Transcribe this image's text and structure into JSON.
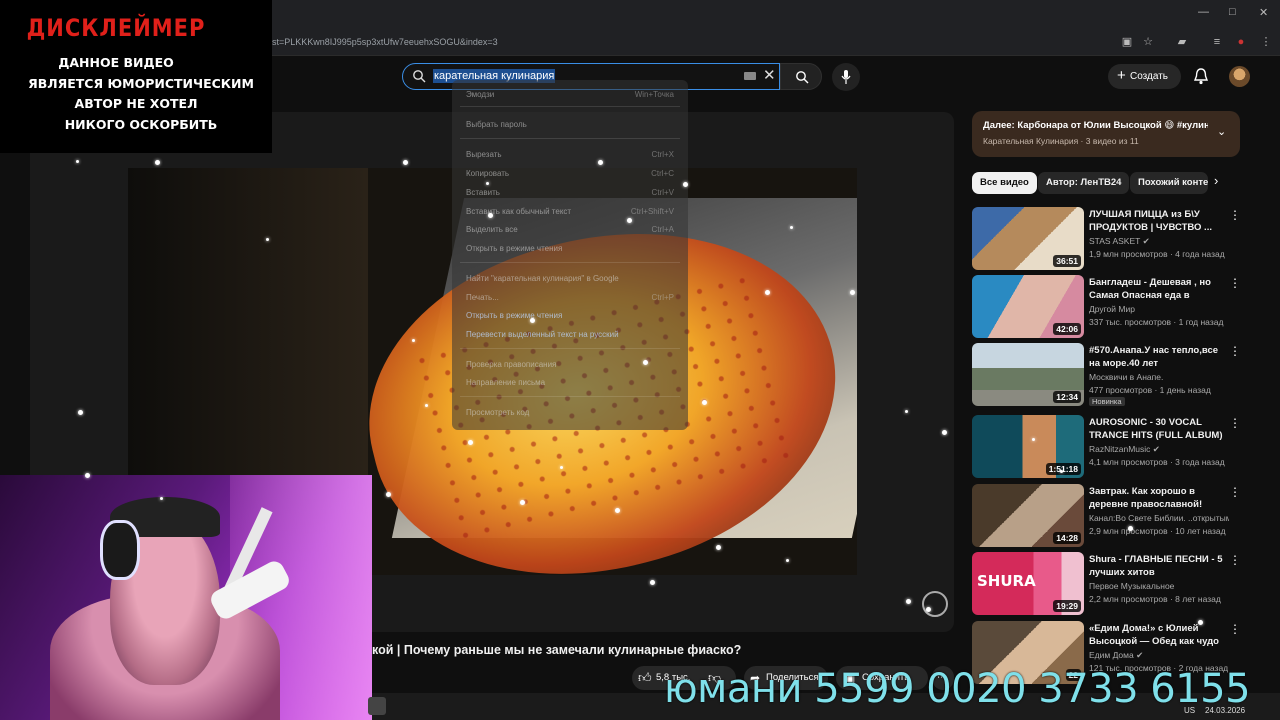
{
  "browser": {
    "url": "st=PLKKKwn8IJ995p5sp3xtUfw7eeuehxSOGU&index=3"
  },
  "header": {
    "search_value": "карательная кулинария",
    "create_label": "Создать"
  },
  "context_menu": {
    "items": [
      {
        "label": "Эмодзи",
        "shortcut": "Win+Точка"
      },
      {
        "label": "Выбрать пароль",
        "shortcut": ""
      },
      {
        "label": "Вырезать",
        "shortcut": "Ctrl+X"
      },
      {
        "label": "Копировать",
        "shortcut": "Ctrl+C"
      },
      {
        "label": "Вставить",
        "shortcut": "Ctrl+V"
      },
      {
        "label": "Вставить как обычный текст",
        "shortcut": "Ctrl+Shift+V"
      },
      {
        "label": "Выделить все",
        "shortcut": "Ctrl+A"
      },
      {
        "label": "Открыть в режиме чтения",
        "shortcut": ""
      },
      {
        "label": "Найти \"карательная кулинария\" в Google",
        "shortcut": ""
      },
      {
        "label": "Печать...",
        "shortcut": "Ctrl+P"
      },
      {
        "label": "Открыть в режиме чтения",
        "shortcut": ""
      },
      {
        "label": "Перевести выделенный текст на русский",
        "shortcut": ""
      },
      {
        "label": "Проверка правописания",
        "shortcut": ""
      },
      {
        "label": "Направление письма",
        "shortcut": ""
      },
      {
        "label": "Просмотреть код",
        "shortcut": ""
      }
    ]
  },
  "disclaimer": {
    "title": "ДИСКЛЕЙМЕР",
    "lines": [
      "ДАННОЕ ВИДЕО",
      "ЯВЛЯЕТСЯ ЮМОРИСТИЧЕСКИМ",
      "АВТОР НЕ ХОТЕЛ",
      "НИКОГО ОСКОРБИТЬ"
    ]
  },
  "video": {
    "title": "кой | Почему раньше мы не замечали кулинарные фиаско?",
    "likes": "5,8 тыс.",
    "share_label": "Поделиться",
    "save_label": "Сохранить"
  },
  "up_next": {
    "title": "Далее: Карбонара от Юлии Высоцкой 😄 #кулинария",
    "subtitle": "Карательная Кулинария · 3 видео из 11"
  },
  "chips": [
    "Все видео",
    "Автор: ЛенТВ24",
    "Похожий контент"
  ],
  "recommendations": [
    {
      "title": "ЛУЧШАЯ ПИЦЦА из Б\\У ПРОДУКТОВ | ЧУВСТВО ...",
      "channel": "STAS ASKET",
      "verified": true,
      "meta": "1,9 млн просмотров · 4 года назад",
      "duration": "36:51",
      "badge": "",
      "thumb_color": "#7a6a52"
    },
    {
      "title": "Бангладеш - Дешевая , но Самая Опасная еда в МИРЕ!!!",
      "channel": "Другой Мир",
      "verified": false,
      "meta": "337 тыс. просмотров · 1 год назад",
      "duration": "42:06",
      "badge": "",
      "thumb_color": "#c08080"
    },
    {
      "title": "#570.Анапа.У нас тепло,все на море.40 лет Победы.Белка, ...",
      "channel": "Москвичи в Анапе.",
      "verified": false,
      "meta": "477 просмотров · 1 день назад",
      "duration": "12:34",
      "badge": "Новинка",
      "thumb_color": "#6a7a6a"
    },
    {
      "title": "AUROSONIC - 30 VOCAL TRANCE HITS (FULL ALBUM)",
      "channel": "RazNitzanMusic",
      "verified": true,
      "meta": "4,1 млн просмотров · 3 года назад",
      "duration": "1:51:18",
      "badge": "",
      "thumb_color": "#1a6a7a"
    },
    {
      "title": "Завтрак. Как хорошо в деревне православной!",
      "channel": "Канал:Во Свете Библии. ..открытым о...",
      "verified": false,
      "meta": "2,9 млн просмотров · 10 лет назад",
      "duration": "14:28",
      "badge": "",
      "thumb_color": "#6a5a4a"
    },
    {
      "title": "Shura - ГЛАВНЫЕ ПЕСНИ - 5 лучших хитов",
      "channel": "Первое Музыкальное",
      "verified": false,
      "meta": "2,2 млн просмотров · 8 лет назад",
      "duration": "19:29",
      "badge": "",
      "thumb_color": "#c23a6a"
    },
    {
      "title": "«Едим Дома!» с Юлией Высоцкой — Обед как чудо ...",
      "channel": "Едим Дома",
      "verified": true,
      "meta": "121 тыс. просмотров · 2 года назад",
      "duration": "22",
      "badge": "",
      "thumb_color": "#7a5a3a"
    }
  ],
  "donation_text": "юмани 5599 0020 3733 6155",
  "tray": {
    "lang": "US",
    "date": "24.03.2026"
  }
}
